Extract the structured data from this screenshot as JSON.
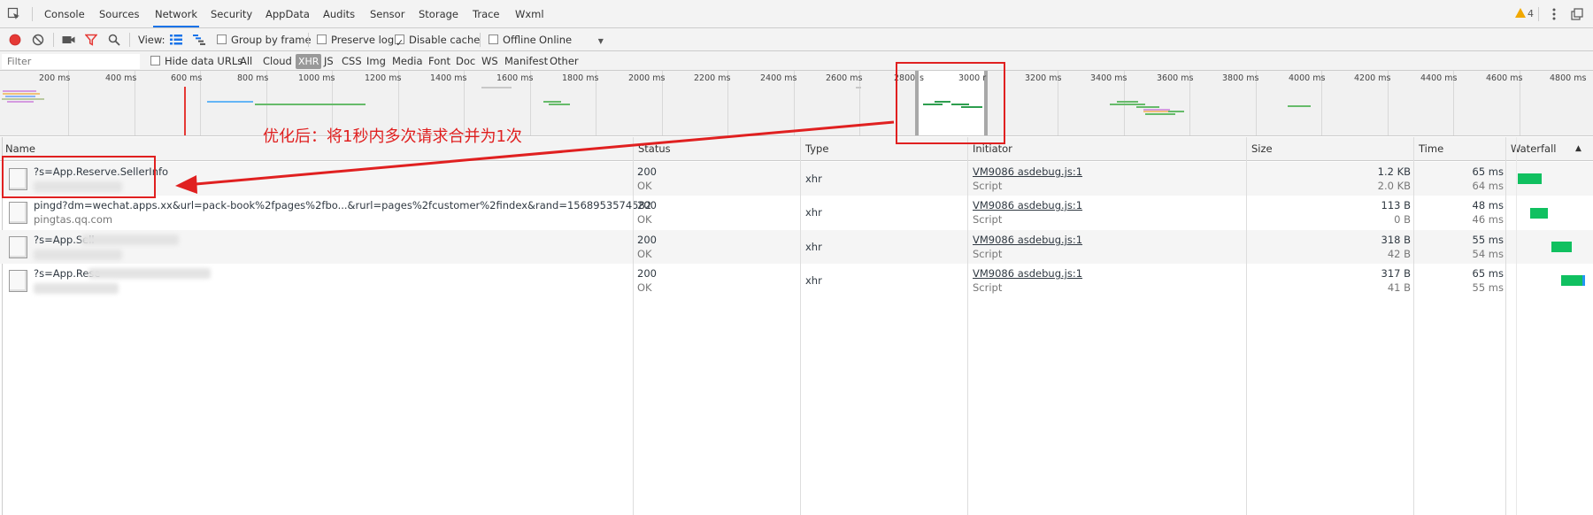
{
  "tabs": {
    "items": [
      "Console",
      "Sources",
      "Network",
      "Security",
      "AppData",
      "Audits",
      "Sensor",
      "Storage",
      "Trace",
      "Wxml"
    ],
    "active": "Network",
    "warning_count": "4"
  },
  "toolbar": {
    "view_label": "View:",
    "group_by_frame": "Group by frame",
    "preserve_log": "Preserve log",
    "disable_cache": "Disable cache",
    "offline": "Offline",
    "throttle": "Online",
    "group_by_frame_checked": false,
    "preserve_log_checked": false,
    "disable_cache_checked": true,
    "offline_checked": false
  },
  "filterbar": {
    "placeholder": "Filter",
    "hide_data_urls": "Hide data URLs",
    "types": [
      "All",
      "Cloud",
      "XHR",
      "JS",
      "CSS",
      "Img",
      "Media",
      "Font",
      "Doc",
      "WS",
      "Manifest",
      "Other"
    ],
    "active_type": "XHR"
  },
  "overview": {
    "ticks": [
      "200 ms",
      "400 ms",
      "600 ms",
      "800 ms",
      "1000 ms",
      "1200 ms",
      "1400 ms",
      "1600 ms",
      "1800 ms",
      "2000 ms",
      "2200 ms",
      "2400 ms",
      "2600 ms",
      "2800",
      "s",
      "3000 r",
      "3200 ms",
      "3400 ms",
      "3600 ms",
      "3800 ms",
      "4000 ms",
      "4200 ms",
      "4400 ms",
      "4600 ms",
      "4800 ms"
    ]
  },
  "annotation": {
    "text": "优化后：将1秒内多次请求合并为1次"
  },
  "table": {
    "headers": {
      "name": "Name",
      "status": "Status",
      "type": "Type",
      "initiator": "Initiator",
      "size": "Size",
      "time": "Time",
      "waterfall": "Waterfall"
    },
    "rows": [
      {
        "name": "?s=App.Reserve.SellerInfo",
        "domain": "",
        "status": "200",
        "status_text": "OK",
        "type": "xhr",
        "initiator": "VM9086 asdebug.js:1",
        "initiator_type": "Script",
        "size": "1.2 KB",
        "size_resource": "2.0 KB",
        "time": "65 ms",
        "latency": "64 ms"
      },
      {
        "name": "pingd?dm=wechat.apps.xx&url=pack-book%2fpages%2fbo...&rurl=pages%2fcustomer%2findex&rand=1568953574582",
        "domain": "pingtas.qq.com",
        "status": "200",
        "status_text": "OK",
        "type": "xhr",
        "initiator": "VM9086 asdebug.js:1",
        "initiator_type": "Script",
        "size": "113 B",
        "size_resource": "0 B",
        "time": "48 ms",
        "latency": "46 ms"
      },
      {
        "name": "?s=App.Sell",
        "domain": "",
        "status": "200",
        "status_text": "OK",
        "type": "xhr",
        "initiator": "VM9086 asdebug.js:1",
        "initiator_type": "Script",
        "size": "318 B",
        "size_resource": "42 B",
        "time": "55 ms",
        "latency": "54 ms"
      },
      {
        "name": "?s=App.Rese",
        "domain": "",
        "status": "200",
        "status_text": "OK",
        "type": "xhr",
        "initiator": "VM9086 asdebug.js:1",
        "initiator_type": "Script",
        "size": "317 B",
        "size_resource": "41 B",
        "time": "65 ms",
        "latency": "55 ms"
      }
    ]
  },
  "colors": {
    "accent": "#1a73e8",
    "record": "#e53935",
    "annotation": "#e02020",
    "waterfall_green": "#10c060",
    "warning": "#f1a800"
  }
}
